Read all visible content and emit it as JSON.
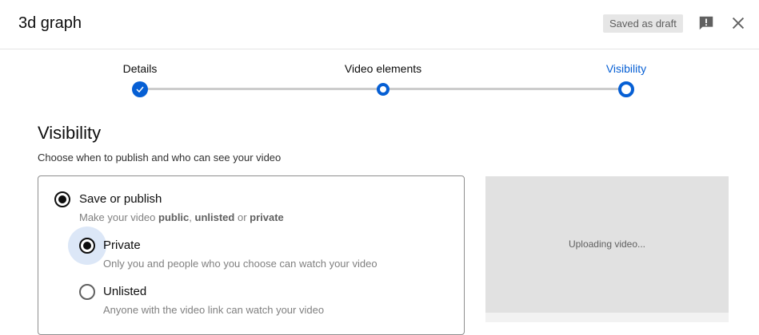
{
  "header": {
    "title": "3d graph",
    "saved_badge": "Saved as draft"
  },
  "stepper": {
    "steps": [
      {
        "label": "Details",
        "state": "done"
      },
      {
        "label": "Video elements",
        "state": "complete-pending"
      },
      {
        "label": "Visibility",
        "state": "current"
      }
    ],
    "accent": "#065fd4"
  },
  "main": {
    "heading": "Visibility",
    "subheading": "Choose when to publish and who can see your video",
    "save_publish": {
      "label": "Save or publish",
      "desc_prefix": "Make your video ",
      "public": "public",
      "sep1": ", ",
      "unlisted": "unlisted",
      "sep2": " or ",
      "private": "private"
    },
    "options": [
      {
        "label": "Private",
        "desc": "Only you and people who you choose can watch your video",
        "selected": true
      },
      {
        "label": "Unlisted",
        "desc": "Anyone with the video link can watch your video",
        "selected": false
      }
    ]
  },
  "preview": {
    "status": "Uploading video..."
  }
}
